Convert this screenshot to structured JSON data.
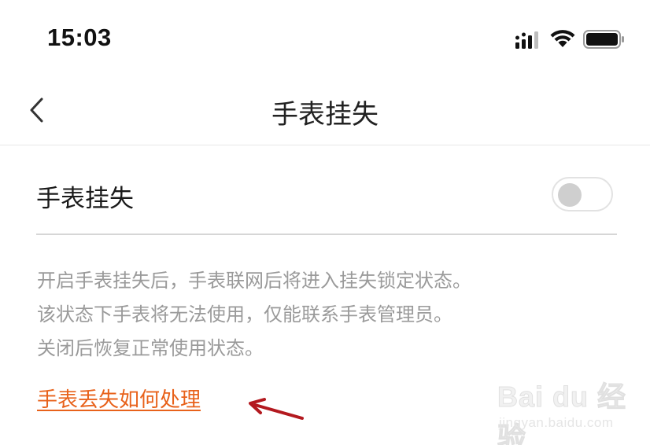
{
  "status_bar": {
    "time": "15:03",
    "icons": [
      "signal-icon",
      "wifi-icon",
      "battery-icon"
    ]
  },
  "nav": {
    "back_icon": "chevron-left-icon",
    "title": "手表挂失"
  },
  "setting": {
    "label": "手表挂失",
    "toggle_on": false
  },
  "description": {
    "lines": [
      "开启手表挂失后，手表联网后将进入挂失锁定状态。",
      "该状态下手表将无法使用，仅能联系手表管理员。",
      "关闭后恢复正常使用状态。"
    ]
  },
  "help_link": {
    "label": "手表丢失如何处理"
  },
  "watermark": {
    "brand": "Bai du 经验",
    "url": "jingyan.baidu.com"
  },
  "colors": {
    "link": "#e8621b",
    "arrow": "#b3191f",
    "description_text": "#9a9a9a",
    "divider": "#d6d6d6"
  }
}
